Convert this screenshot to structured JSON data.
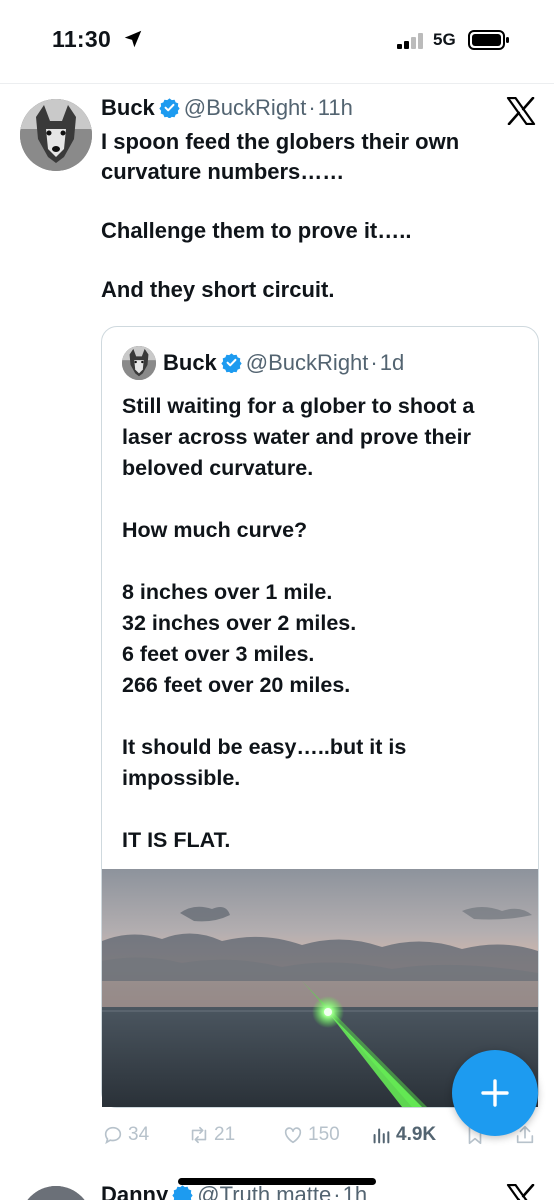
{
  "status_bar": {
    "time": "11:30",
    "network": "5G"
  },
  "tweet": {
    "author_name": "Buck",
    "handle": "@BuckRight",
    "separator": "·",
    "time": "11h",
    "lines": [
      "I spoon feed the globers their own curvature numbers……",
      "Challenge them to prove it…..",
      "And they short circuit."
    ]
  },
  "quote": {
    "author_name": "Buck",
    "handle": "@BuckRight",
    "separator": "·",
    "time": "1d",
    "paragraphs": [
      "Still waiting for a glober to shoot a laser across water and prove their beloved curvature.",
      "How much curve?",
      "8 inches over 1 mile.\n32 inches  over 2 miles.\n6 feet over 3 miles.\n266 feet over 20 miles.",
      "It should be easy…..but it is impossible.",
      "IT IS FLAT."
    ]
  },
  "actions": {
    "replies": "34",
    "reposts": "21",
    "likes": "150",
    "views": "4.9K"
  },
  "next_tweet": {
    "author_name": "Danny",
    "handle": "@Truth matte",
    "separator": "·",
    "time": "1h"
  },
  "icons": [
    "location-arrow-icon",
    "signal-icon",
    "battery-icon",
    "verified-badge-icon",
    "x-logo-icon",
    "reply-icon",
    "repost-icon",
    "like-icon",
    "views-icon",
    "bookmark-icon",
    "share-icon",
    "plus-icon"
  ],
  "colors": {
    "accent": "#1d9bf0",
    "text": "#0f1419",
    "secondary": "#536471",
    "action_gray": "#b7c2cb",
    "border": "#cfd9de"
  }
}
